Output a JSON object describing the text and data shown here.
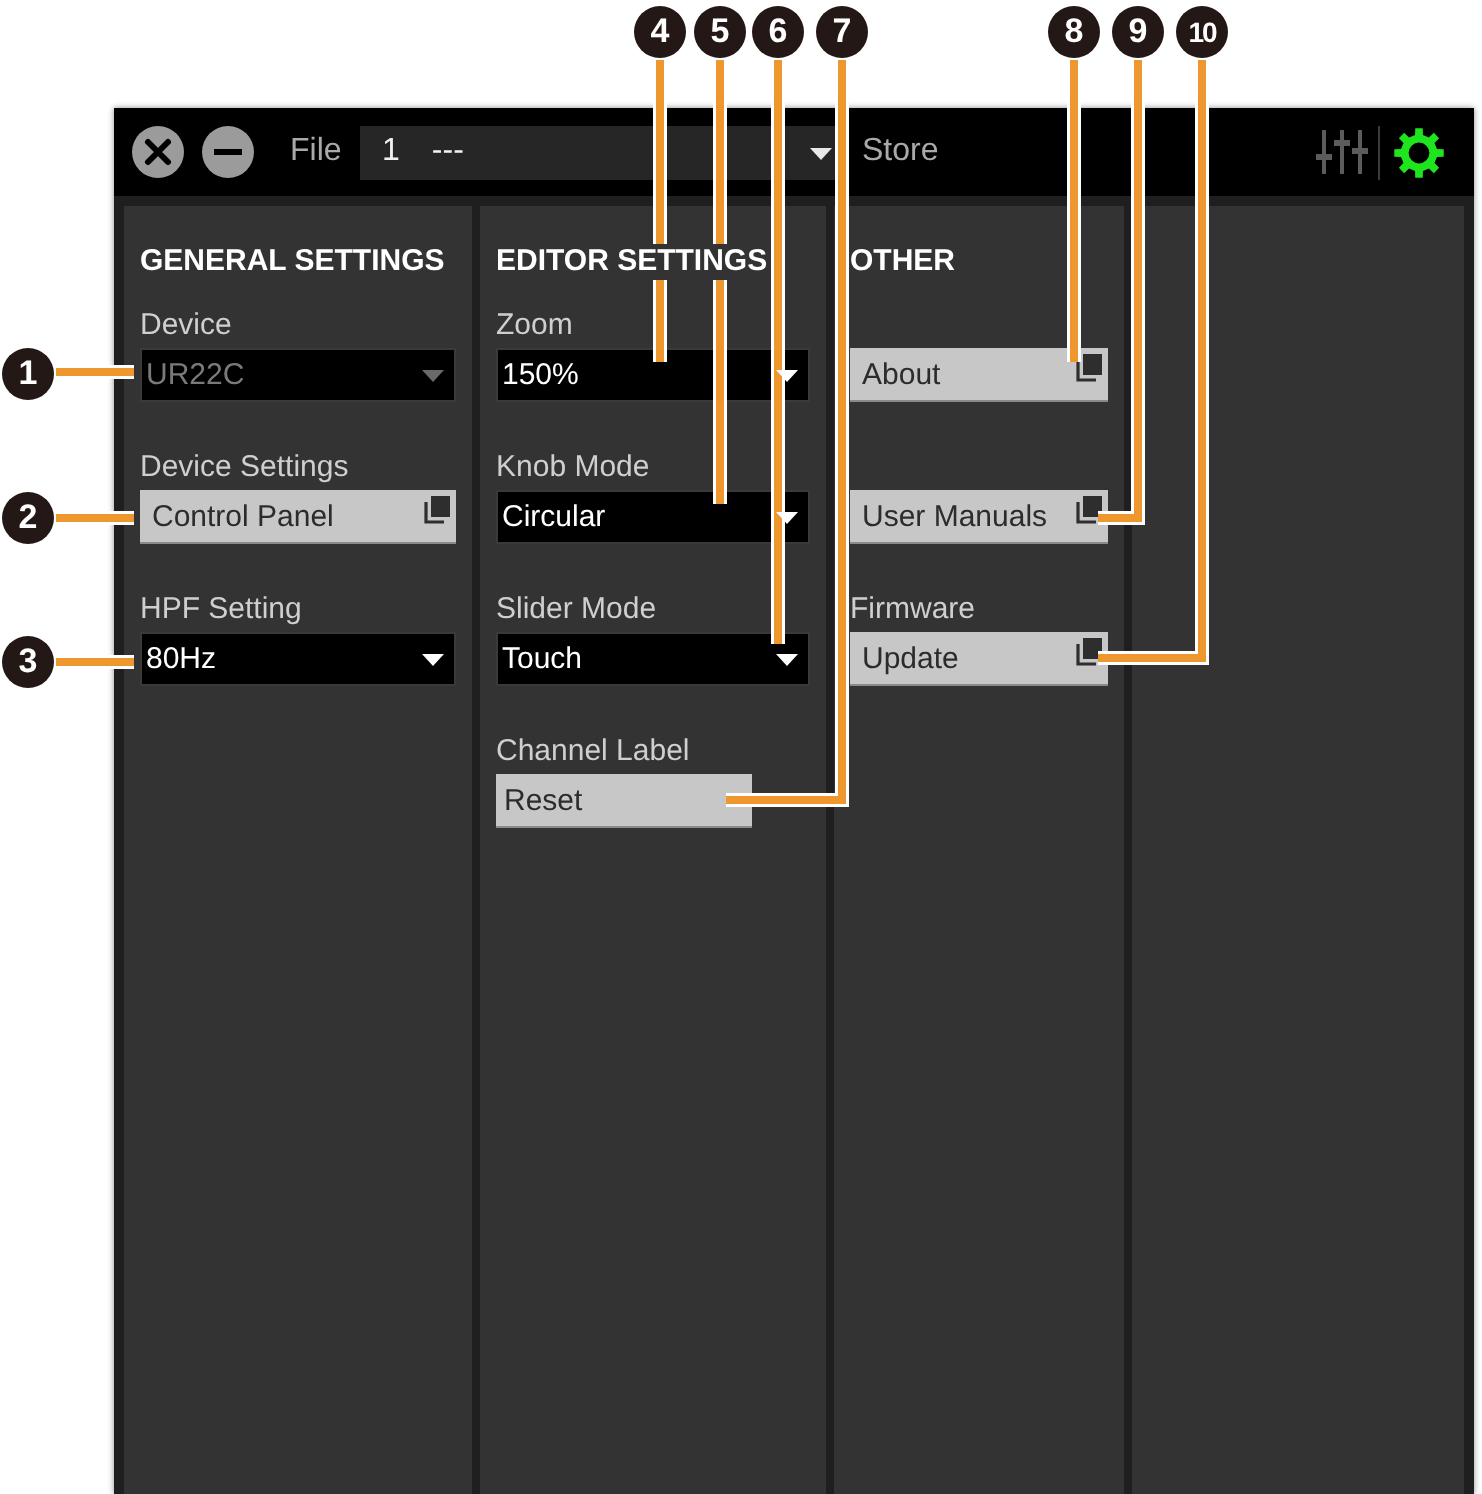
{
  "window": {
    "file_label": "File",
    "file_number": "1",
    "file_name": "---",
    "store_label": "Store",
    "views": [
      {
        "kind": "mixer",
        "selected": false
      },
      {
        "kind": "settings",
        "selected": true
      }
    ]
  },
  "sections": [
    {
      "title": "GENERAL SETTINGS",
      "items": [
        {
          "kind": "dropdown",
          "label": "Device",
          "value": "UR22C",
          "disabled": true
        },
        {
          "kind": "window_button",
          "label": "Device Settings",
          "value": "Control Panel",
          "disabled": false
        },
        {
          "kind": "dropdown",
          "label": "HPF Setting",
          "value": "80Hz",
          "disabled": false
        }
      ]
    },
    {
      "title": "EDITOR SETTINGS",
      "items": [
        {
          "kind": "dropdown",
          "label": "Zoom",
          "value": "150%",
          "disabled": false
        },
        {
          "kind": "dropdown",
          "label": "Knob Mode",
          "value": "Circular",
          "disabled": false
        },
        {
          "kind": "dropdown",
          "label": "Slider Mode",
          "value": "Touch",
          "disabled": false
        },
        {
          "kind": "button",
          "label": "Channel Label",
          "value": "Reset",
          "disabled": false
        }
      ]
    },
    {
      "title": "OTHER",
      "items": [
        {
          "kind": "window_button",
          "value": "About",
          "disabled": false
        },
        {
          "kind": "window_button",
          "value": "User Manuals",
          "disabled": false
        },
        {
          "kind": "window_button",
          "label": "Firmware",
          "value": "Update",
          "disabled": false
        }
      ]
    }
  ],
  "callouts": [
    "1",
    "2",
    "3",
    "4",
    "5",
    "6",
    "7",
    "8",
    "9",
    "10"
  ]
}
